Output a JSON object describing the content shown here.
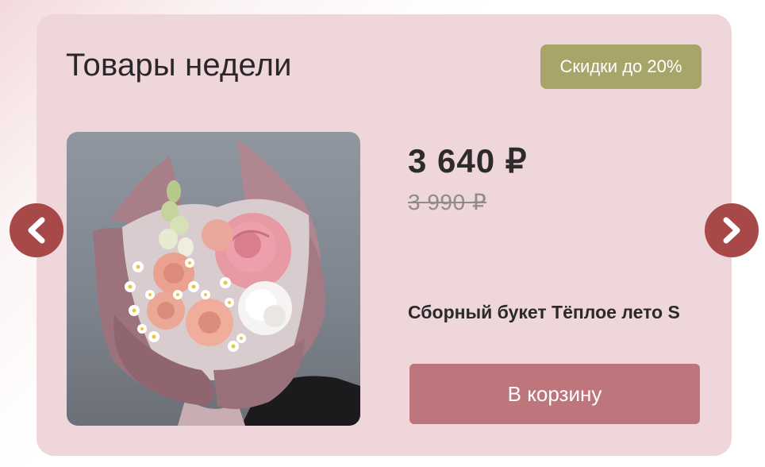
{
  "section": {
    "title": "Товары недели",
    "badge": "Скидки до 20%"
  },
  "product": {
    "price": "3 640 ₽",
    "old_price": "3 990 ₽",
    "name": "Сборный букет Тёплое лето S",
    "cart_button": "В корзину",
    "image_icon": "bouquet-image"
  },
  "navigation": {
    "prev_icon": "chevron-left-icon",
    "next_icon": "chevron-right-icon"
  },
  "colors": {
    "card_background": "#eed6da",
    "badge": "#a8a56b",
    "cart_button": "#be757c",
    "arrow": "#a64948"
  }
}
